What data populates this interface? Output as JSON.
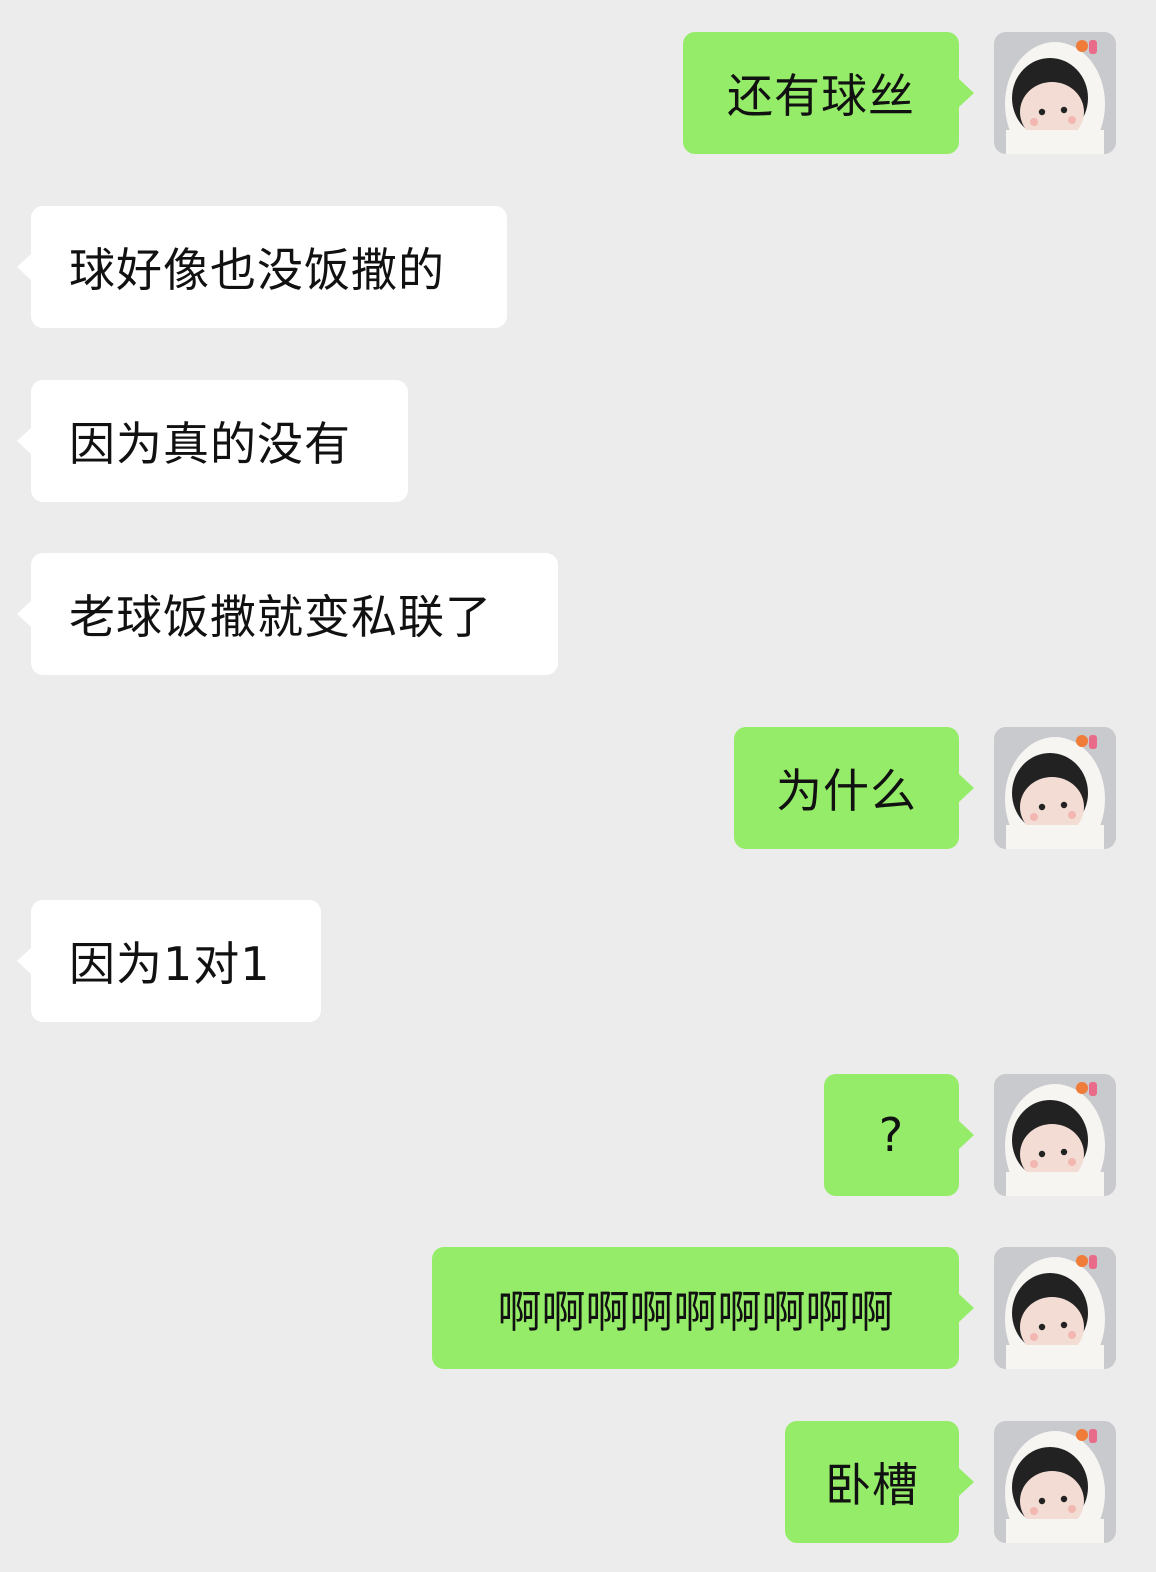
{
  "conversation": {
    "messages": [
      {
        "side": "out",
        "text": "还有球丝"
      },
      {
        "side": "in",
        "text": "球好像也没饭撒的"
      },
      {
        "side": "in",
        "text": "因为真的没有"
      },
      {
        "side": "in",
        "text": "老球饭撒就变私联了"
      },
      {
        "side": "out",
        "text": "为什么"
      },
      {
        "side": "in",
        "text": "因为1对1"
      },
      {
        "side": "out",
        "text": "?"
      },
      {
        "side": "out",
        "text": "啊啊啊啊啊啊啊啊啊"
      },
      {
        "side": "out",
        "text": "卧槽"
      }
    ]
  },
  "colors": {
    "background": "#ececec",
    "incoming_bubble": "#ffffff",
    "outgoing_bubble": "#95ec69",
    "text": "#111111"
  },
  "icons": {
    "self_avatar": "plush-doll-avatar"
  }
}
